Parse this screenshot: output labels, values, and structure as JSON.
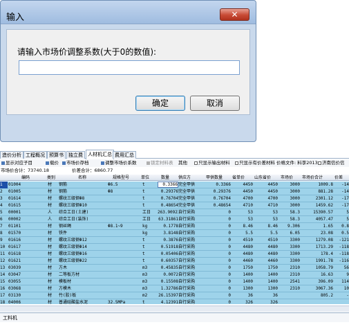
{
  "dialog": {
    "title": "输入",
    "close_label": "✕",
    "prompt": "请输入市场价调整系数(大于0的数值):",
    "input_value": "",
    "ok_label": "确定",
    "cancel_label": "取消"
  },
  "tabs": [
    {
      "label": "造价分析"
    },
    {
      "label": "工程概况"
    },
    {
      "label": "预算书"
    },
    {
      "label": "独立费"
    },
    {
      "label": "人材机汇总"
    },
    {
      "label": "费用汇总"
    }
  ],
  "toolbar": {
    "show_items": "显示对应子目",
    "price_sort": "载价",
    "market_price_storage": "市场价存档",
    "adjust_factor": "调整市场价系数",
    "lock_material": "锁定材料表",
    "other": "其他",
    "only_output_material": "只显示输出材料",
    "only_price_diff": "只显示有价差材料",
    "price_file": "价格文件: 料李2013",
    "jinan_info": "济南信价信"
  },
  "summary": {
    "market_total": "市场价合计：73740.18",
    "price_diff_total": "价差合计：6860.77"
  },
  "headers": [
    "编码",
    "类别",
    "名称",
    "规格型号",
    "单位",
    "数量",
    "供应方",
    "甲供数量",
    "省单价",
    "山东省价",
    "市场价",
    "市场价合计",
    "价差"
  ],
  "rows": [
    {
      "no": "1",
      "code": "01004",
      "type": "材",
      "name": "钢筋",
      "spec": "Φ6.5",
      "unit": "t",
      "qty": "0.3366",
      "supplier": "完全甲供",
      "jia": "0.3366",
      "sheng": "4450",
      "sd": "4450",
      "market": "3000",
      "total": "1009.8",
      "diff": "-14"
    },
    {
      "no": "2",
      "code": "01005",
      "type": "材",
      "name": "钢筋",
      "spec": "Φ8",
      "unit": "t",
      "qty": "0.29376",
      "supplier": "完全甲供",
      "jia": "0.29376",
      "sheng": "4450",
      "sd": "4450",
      "market": "3000",
      "total": "881.28",
      "diff": "-14"
    },
    {
      "no": "3",
      "code": "01614",
      "type": "材",
      "name": "螺纹三级钢Φ8",
      "spec": "",
      "unit": "t",
      "qty": "0.76704",
      "supplier": "完全甲供",
      "jia": "0.76704",
      "sheng": "4700",
      "sd": "4700",
      "market": "3000",
      "total": "2301.12",
      "diff": "-17"
    },
    {
      "no": "4",
      "code": "01615",
      "type": "材",
      "name": "螺纹三级钢Φ10",
      "spec": "",
      "unit": "t",
      "qty": "0.48654",
      "supplier": "完全甲供",
      "jia": "0.48654",
      "sheng": "4710",
      "sd": "4710",
      "market": "3000",
      "total": "1459.62",
      "diff": "-17"
    },
    {
      "no": "5",
      "code": "00001",
      "type": "人",
      "name": "综合工日(土建)",
      "spec": "",
      "unit": "工日",
      "qty": "263.90923",
      "supplier": "自行采购",
      "jia": "0",
      "sheng": "53",
      "sd": "53",
      "market": "58.3",
      "total": "15390.57",
      "diff": "5"
    },
    {
      "no": "6",
      "code": "00002",
      "type": "人",
      "name": "综合工日(装饰)",
      "spec": "",
      "unit": "工日",
      "qty": "63.31861",
      "supplier": "自行采购",
      "jia": "0",
      "sheng": "53",
      "sd": "53",
      "market": "58.3",
      "total": "4057.47",
      "diff": "5"
    },
    {
      "no": "7",
      "code": "01101",
      "type": "材",
      "name": "钢丝绳",
      "spec": "Φ8.1~9",
      "unit": "kg",
      "qty": "0.1778",
      "supplier": "自行采购",
      "jia": "0",
      "sheng": "8.46",
      "sd": "8.46",
      "market": "9.306",
      "total": "1.65",
      "diff": "0.8"
    },
    {
      "no": "8",
      "code": "01570",
      "type": "材",
      "name": "铁件",
      "spec": "",
      "unit": "kg",
      "qty": "3.8148",
      "supplier": "自行采购",
      "jia": "0",
      "sheng": "5.5",
      "sd": "5.5",
      "market": "6.05",
      "total": "23.08",
      "diff": "0.5"
    },
    {
      "no": "9",
      "code": "01616",
      "type": "材",
      "name": "螺纹三级钢Φ12",
      "spec": "",
      "unit": "t",
      "qty": "0.3876",
      "supplier": "自行采购",
      "jia": "0",
      "sheng": "4510",
      "sd": "4510",
      "market": "3300",
      "total": "1279.08",
      "diff": "-121"
    },
    {
      "no": "10",
      "code": "01617",
      "type": "材",
      "name": "螺纹三级钢Φ14",
      "spec": "",
      "unit": "t",
      "qty": "0.51918",
      "supplier": "自行采购",
      "jia": "0",
      "sheng": "4480",
      "sd": "4480",
      "market": "3300",
      "total": "1713.29",
      "diff": "-118"
    },
    {
      "no": "11",
      "code": "01618",
      "type": "材",
      "name": "螺纹三级钢Φ16",
      "spec": "",
      "unit": "t",
      "qty": "0.05406",
      "supplier": "自行采购",
      "jia": "0",
      "sheng": "4480",
      "sd": "4480",
      "market": "3300",
      "total": "178.4",
      "diff": "-118"
    },
    {
      "no": "12",
      "code": "01621",
      "type": "材",
      "name": "螺纹三级钢Φ22",
      "spec": "",
      "unit": "t",
      "qty": "0.60357",
      "supplier": "自行采购",
      "jia": "0",
      "sheng": "4460",
      "sd": "4460",
      "market": "3300",
      "total": "1991.78",
      "diff": "-116"
    },
    {
      "no": "13",
      "code": "03039",
      "type": "材",
      "name": "方木",
      "spec": "",
      "unit": "m3",
      "qty": "0.45835",
      "supplier": "自行采购",
      "jia": "0",
      "sheng": "1750",
      "sd": "1750",
      "market": "2310",
      "total": "1058.79",
      "diff": "56"
    },
    {
      "no": "14",
      "code": "03047",
      "type": "材",
      "name": "二等板方材",
      "spec": "",
      "unit": "m3",
      "qty": "0.0072",
      "supplier": "自行采购",
      "jia": "0",
      "sheng": "1400",
      "sd": "1400",
      "market": "2310",
      "total": "16.63",
      "diff": "9"
    },
    {
      "no": "15",
      "code": "03055",
      "type": "材",
      "name": "模板材",
      "spec": "",
      "unit": "m3",
      "qty": "0.15508",
      "supplier": "自行采购",
      "jia": "0",
      "sheng": "1400",
      "sd": "1400",
      "market": "2541",
      "total": "396.09",
      "diff": "114"
    },
    {
      "no": "16",
      "code": "03068",
      "type": "材",
      "name": "方模木",
      "spec": "",
      "unit": "m3",
      "qty": "1.32786",
      "supplier": "自行采购",
      "jia": "0",
      "sheng": "1300",
      "sd": "1300",
      "market": "2310",
      "total": "3067.36",
      "diff": "10"
    },
    {
      "no": "17",
      "code": "03130",
      "type": "材",
      "name": "竹(胶)板",
      "spec": "",
      "unit": "m2",
      "qty": "26.15397",
      "supplier": "自行采购",
      "jia": "0",
      "sheng": "36",
      "sd": "36",
      "market": "",
      "total": "805.2",
      "diff": "-"
    },
    {
      "no": "18",
      "code": "04006",
      "type": "材",
      "name": "普通硅酸盐水泥",
      "spec": "32.5MPa",
      "unit": "t",
      "qty": "4.12391",
      "supplier": "自行采购",
      "jia": "0",
      "sheng": "326",
      "sd": "326",
      "market": "",
      "total": "",
      "diff": ""
    }
  ],
  "status": {
    "left": "工料机"
  },
  "colors": {
    "row_bg": "#9ed3ea",
    "dialog_bg": "#c9d9ec",
    "close_red": "#c84a34",
    "selected_row": "#1c4fa8"
  }
}
